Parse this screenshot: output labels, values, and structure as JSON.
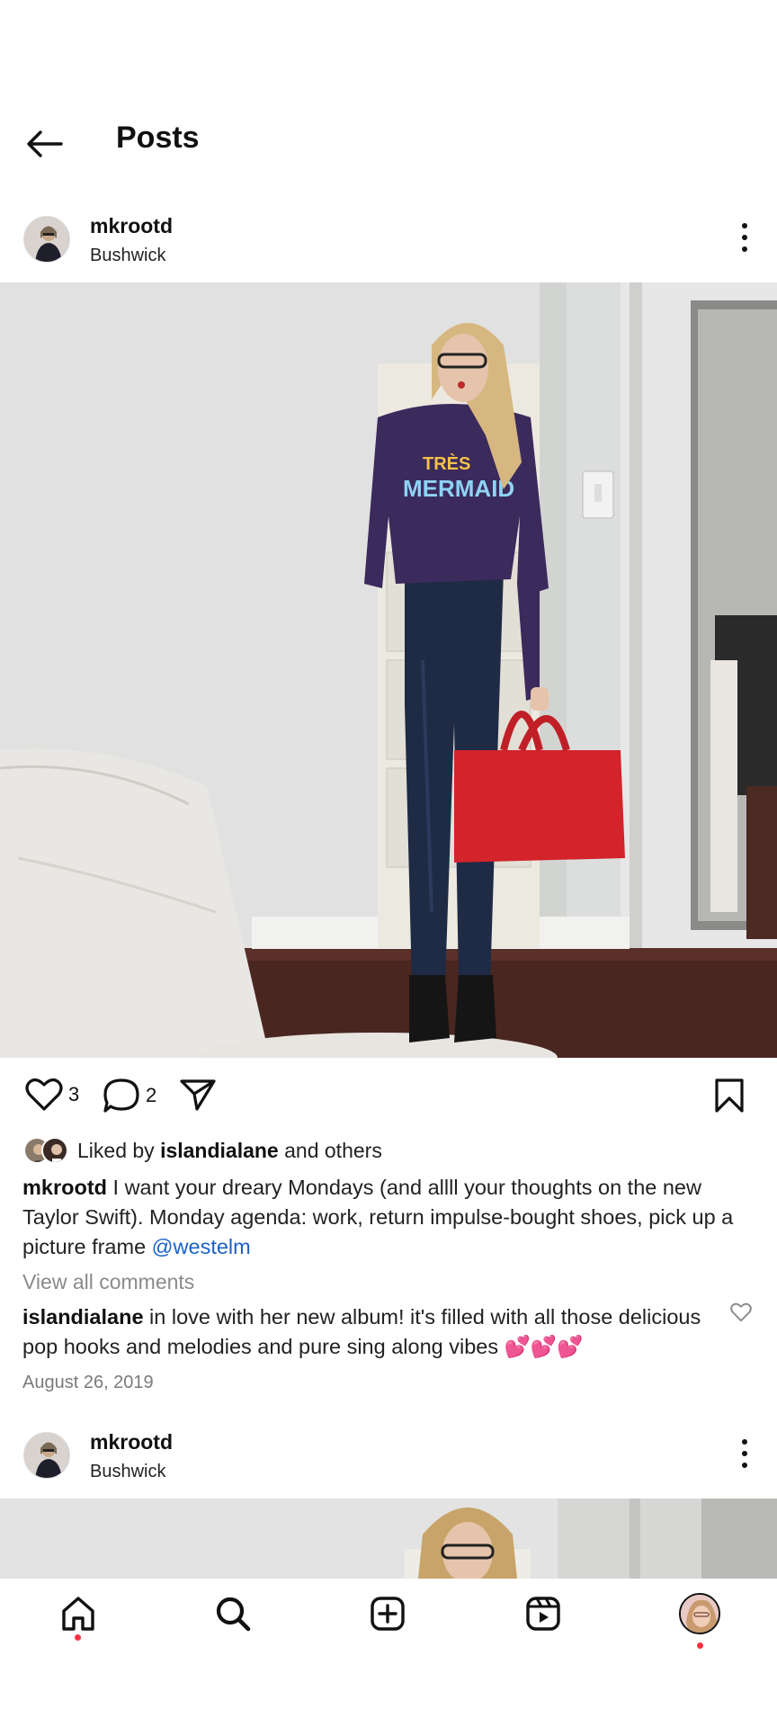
{
  "header": {
    "title": "Posts",
    "back_icon": "arrow-left-icon"
  },
  "posts": [
    {
      "username": "mkrootd",
      "location": "Bushwick",
      "image_alt": "Woman in TRÈS MERMAID sweater holding a red handbag",
      "sweater_text_1": "TRÈS",
      "sweater_text_2": "MERMAID",
      "likes_count": "3",
      "comments_count": "2",
      "liked_by_prefix": "Liked by ",
      "liked_by_user": "islandialane",
      "liked_by_suffix": " and others",
      "caption_user": "mkrootd",
      "caption_text": " I want your dreary Mondays (and allll your thoughts on the new Taylor Swift). Monday agenda: work, return impulse-bought shoes, pick up a picture frame ",
      "caption_mention": "@westelm",
      "view_all_comments": "View all comments",
      "top_comment_user": "islandialane",
      "top_comment_text": " in love with her new album! it's filled with all those delicious pop hooks and melodies and pure sing along vibes 💕💕💕",
      "date": "August 26, 2019"
    },
    {
      "username": "mkrootd",
      "location": "Bushwick"
    }
  ],
  "bottom_nav": {
    "items": [
      "home-icon",
      "search-icon",
      "create-icon",
      "reels-icon",
      "profile-avatar"
    ],
    "notification_color": "#ff3040"
  },
  "colors": {
    "link": "#1a62c7",
    "muted": "#8a8a8a"
  }
}
